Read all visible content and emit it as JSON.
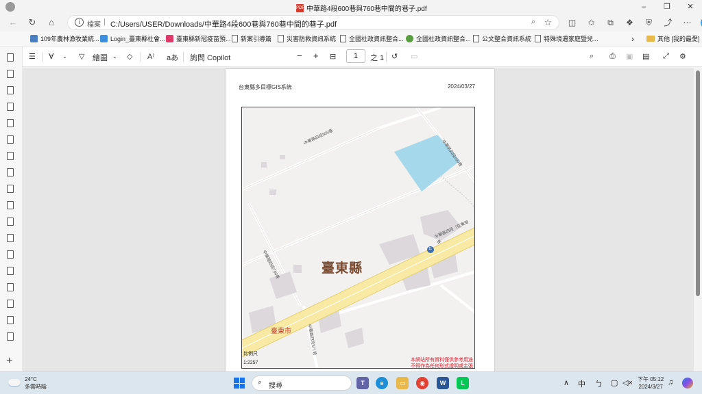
{
  "window": {
    "tab_title": "中華路4段600巷與760巷中間的巷子.pdf",
    "minimize": "–",
    "maximize": "❐",
    "close": "✕"
  },
  "addressbar": {
    "protocol": "檔案",
    "separator": "|",
    "url": "C:/Users/USER/Downloads/中華路4段600巷與760巷中間的巷子.pdf"
  },
  "favorites": {
    "items": [
      {
        "label": "109年農林漁牧業統...",
        "color": "#4a7fc1"
      },
      {
        "label": "Login_臺東縣社會...",
        "color": "#3e8ede"
      },
      {
        "label": "臺東縣新冠疫苗預...",
        "color": "#e0386a"
      },
      {
        "label": "新案引導篇",
        "color": "#666666"
      },
      {
        "label": "災害防救資訊系統",
        "color": "#666666"
      },
      {
        "label": "全國社政資訊整合...",
        "color": "#666666"
      },
      {
        "label": "全國社政資訊整合...",
        "color": "#5a9e42"
      },
      {
        "label": "公文整合資訊系統",
        "color": "#666666"
      },
      {
        "label": "特殊境遇家庭暨兒...",
        "color": "#666666"
      }
    ],
    "overflow": "›",
    "other": "其他 [我的最愛]"
  },
  "pdf_toolbar": {
    "draw_label": "繪圖",
    "copilot_label": "詢問 Copilot",
    "zoom_out": "−",
    "zoom_in": "+",
    "page_current": "1",
    "page_total": "之 1"
  },
  "document": {
    "header_title": "台東縣多目標GIS系統",
    "header_date": "2024/03/27",
    "map_county_label": "臺東縣",
    "map_city_label": "臺東市",
    "road_label_1": "中華路四段600巷",
    "road_label_2": "中華路四段600巷",
    "road_label_3": "中華路四段（花東海岸",
    "road_label_4": "中華路四段760巷",
    "road_label_5": "中華路四段571巷",
    "road_shield": "11",
    "scale_label": "比例尺",
    "scale_value": "1:2257",
    "disclaimer_1": "本網站所有資料僅供參考用途",
    "disclaimer_2": "不得作為任何形式證明或主張"
  },
  "taskbar": {
    "temperature": "24°C",
    "weather_desc": "多雲時陰",
    "search_placeholder": "搜尋",
    "tray_ime": "中",
    "tray_mode": "ㄅ",
    "time": "下午 05:12",
    "date": "2024/3/27"
  }
}
